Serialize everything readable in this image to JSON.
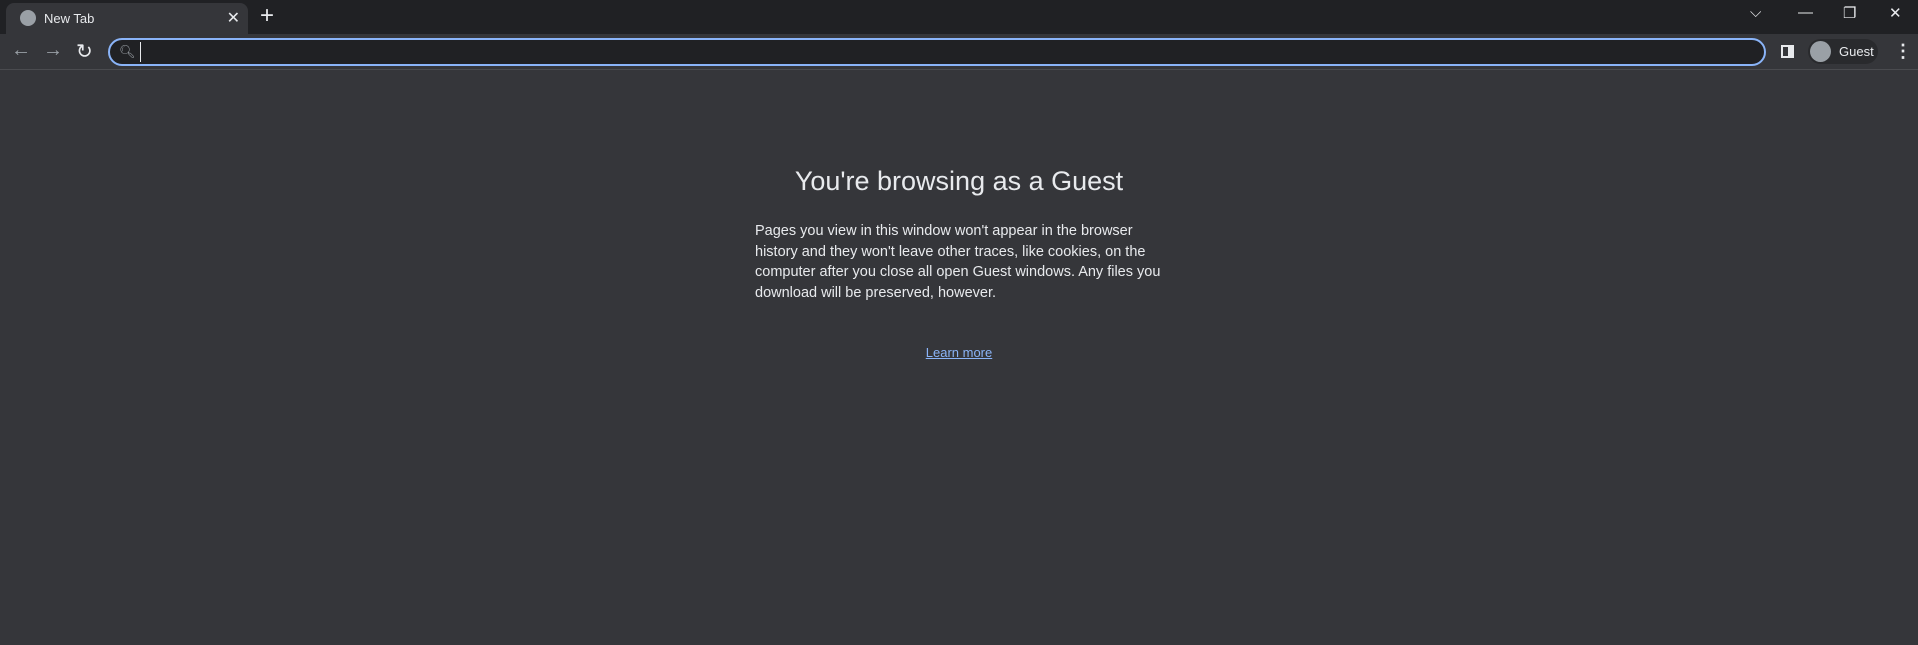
{
  "tab": {
    "title": "New Tab",
    "favicon": "globe-icon"
  },
  "omnibox": {
    "value": "",
    "placeholder": ""
  },
  "profile": {
    "label": "Guest"
  },
  "page": {
    "heading": "You're browsing as a Guest",
    "body": "Pages you view in this window won't appear in the browser history and they won't leave other traces, like cookies, on the computer after you close all open Guest windows. Any files you download will be preserved, however.",
    "link": "Learn more"
  },
  "colors": {
    "accent": "#8ab4f8",
    "background": "#35363a",
    "frame": "#202124"
  }
}
